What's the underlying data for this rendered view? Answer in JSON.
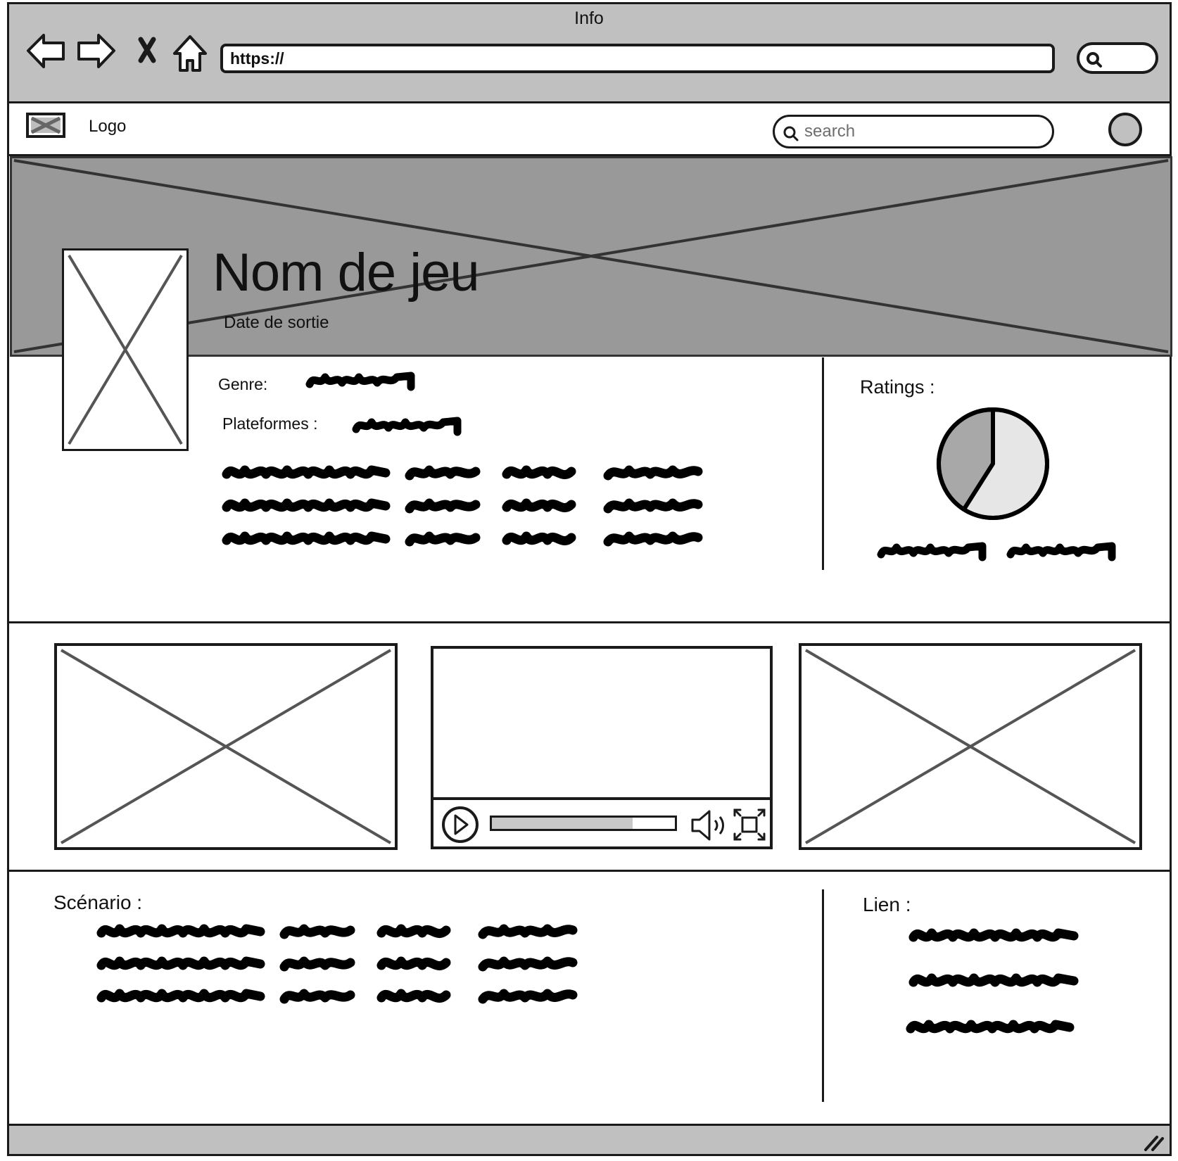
{
  "browser": {
    "window_title": "Info",
    "url": "https://"
  },
  "header": {
    "logo_text": "Logo",
    "search_placeholder": "search"
  },
  "game": {
    "name": "Nom de jeu",
    "release_date_label": "Date de sortie",
    "genre_label": "Genre:",
    "platforms_label": "Plateformes :"
  },
  "ratings": {
    "label": "Ratings :",
    "pie_fractions": [
      0.41,
      0.59
    ]
  },
  "video": {
    "progress": 0.77
  },
  "scenario": {
    "label": "Scénario :"
  },
  "links": {
    "label": "Lien :"
  },
  "colors": {
    "chrome": "#c0c0c0",
    "banner": "#999999",
    "pie_dark": "#a8a8a8",
    "pie_light": "#e6e6e6",
    "ink": "#1a1a1a"
  }
}
